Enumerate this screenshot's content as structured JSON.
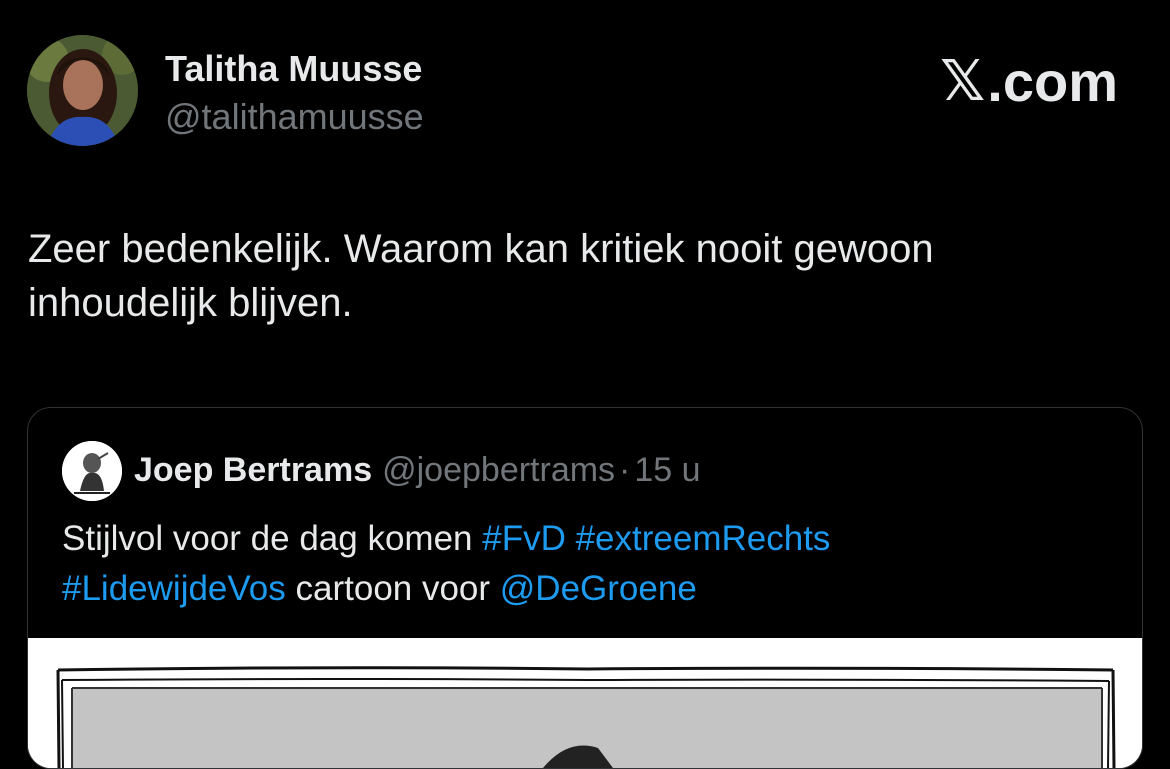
{
  "author": {
    "name": "Talitha Muusse",
    "handle": "@talithamuusse"
  },
  "brand": {
    "x_glyph": "𝕏",
    "text": ".com"
  },
  "tweet": {
    "text": "Zeer bedenkelijk. Waarom kan kritiek nooit gewoon inhoudelijk blijven."
  },
  "quote": {
    "name": "Joep Bertrams",
    "handle": "@joepbertrams",
    "separator": "·",
    "time": "15 u",
    "text_plain_1": "Stijlvol voor de dag komen ",
    "tag_fvd": "#FvD",
    "tag_extreem": "#extreemRechts",
    "tag_lidewij": "#LidewijdeVos",
    "text_plain_2": " cartoon voor ",
    "mention": "@DeGroene"
  },
  "colors": {
    "background": "#000000",
    "text": "#e7e9ea",
    "secondary": "#71767b",
    "link": "#1d9bf0",
    "border": "#2f3336"
  }
}
